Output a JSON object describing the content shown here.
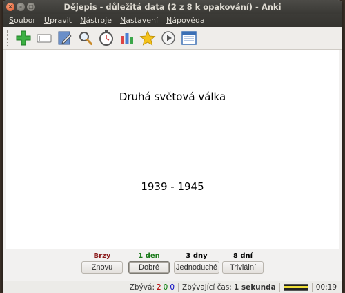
{
  "window": {
    "title": "Dějepis - důležitá data (2 z 8 k opakování) - Anki"
  },
  "menu": [
    {
      "label": "Soubor",
      "accel": "S",
      "rest": "oubor"
    },
    {
      "label": "Upravit",
      "accel": "U",
      "rest": "pravit"
    },
    {
      "label": "Nástroje",
      "accel": "N",
      "rest": "ástroje"
    },
    {
      "label": "Nastavení",
      "accel": "N",
      "rest": "astavení"
    },
    {
      "label": "Nápověda",
      "accel": "N",
      "rest": "ápověda"
    }
  ],
  "toolbar": {
    "icons": [
      "add-icon",
      "card-icon",
      "edit-icon",
      "search-icon",
      "timer-icon",
      "stats-icon",
      "star-icon",
      "play-icon",
      "list-icon"
    ]
  },
  "card": {
    "question": "Druhá světová válka",
    "answer": "1939 - 1945"
  },
  "answers": [
    {
      "interval": "Brzy",
      "label": "Znovu",
      "color": "#8b1a1a"
    },
    {
      "interval": "1 den",
      "label": "Dobré",
      "color": "#1a7a1a"
    },
    {
      "interval": "3 dny",
      "label": "Jednoduché",
      "color": "#000000"
    },
    {
      "interval": "8 dní",
      "label": "Triviální",
      "color": "#000000"
    }
  ],
  "status": {
    "remaining_label": "Zbývá:",
    "remaining_red": "2",
    "remaining_green": "0",
    "remaining_blue": "0",
    "time_label": "Zbývající čas:",
    "time_value": "1 sekunda",
    "elapsed": "00:19"
  },
  "colors": {
    "red": "#b00000",
    "green": "#007a00",
    "blue": "#0000c0"
  }
}
